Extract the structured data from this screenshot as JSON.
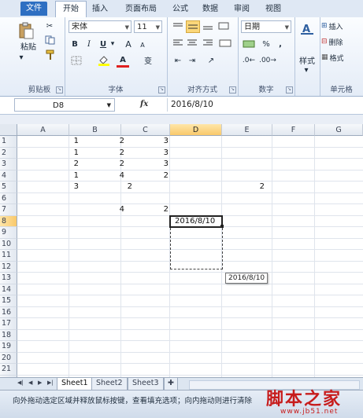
{
  "ribbon_tabs": [
    {
      "label": "文件"
    },
    {
      "label": "开始"
    },
    {
      "label": "插入"
    },
    {
      "label": "页面布局"
    },
    {
      "label": "公式"
    },
    {
      "label": "数据"
    },
    {
      "label": "审阅"
    },
    {
      "label": "视图"
    }
  ],
  "clipboard": {
    "paste_label": "粘贴",
    "group_label": "剪贴板"
  },
  "font": {
    "name": "宋体",
    "size": "11",
    "bold": "B",
    "italic": "I",
    "underline": "U",
    "grow": "A",
    "shrink": "A",
    "group_label": "字体",
    "wen": "变"
  },
  "alignment": {
    "group_label": "对齐方式"
  },
  "number": {
    "format": "日期",
    "percent": "%",
    "comma": ",",
    "group_label": "数字"
  },
  "styles": {
    "label": "样式"
  },
  "cells": {
    "insert": "插入",
    "delete": "删除",
    "format": "格式",
    "group_label": "单元格"
  },
  "formula_bar": {
    "name_box": "D8",
    "fx": "fx",
    "content": "2016/8/10"
  },
  "columns": [
    "A",
    "B",
    "C",
    "D",
    "E",
    "F",
    "G"
  ],
  "rows": [
    "1",
    "2",
    "3",
    "4",
    "5",
    "6",
    "7",
    "8",
    "9",
    "10",
    "11",
    "12",
    "13",
    "14",
    "15",
    "16",
    "17",
    "18",
    "19",
    "20",
    "21",
    "22"
  ],
  "cells_data": {
    "a1": "1",
    "b1": "2",
    "c1": "3",
    "a2": "1",
    "b2": "2",
    "c2": "3",
    "a3": "2",
    "b3": "2",
    "c3": "3",
    "a4": "1",
    "b4": "4",
    "c4": "2",
    "a5": "3",
    "b5": "2",
    "e5": "2",
    "b7": "4",
    "c7": "2",
    "d8": "2016/8/10"
  },
  "tooltip": "2016/8/10",
  "sheets": [
    {
      "label": "Sheet1"
    },
    {
      "label": "Sheet2"
    },
    {
      "label": "Sheet3"
    }
  ],
  "status_text": "向外拖动选定区域并释放鼠标按键，查看填充选项；向内拖动则进行清除",
  "watermark": {
    "text": "脚本之家",
    "url": "www.jb51.net"
  },
  "colors": {
    "file_tab": "#2e6fc2",
    "selection_header": "#f9c96b",
    "watermark": "#c71c1c"
  }
}
